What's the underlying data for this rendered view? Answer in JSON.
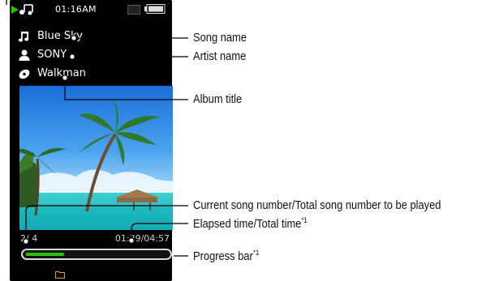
{
  "status_bar": {
    "time": "01:16AM"
  },
  "track": {
    "song": "Blue Sky",
    "artist": "SONY",
    "album": "Walkman"
  },
  "playback": {
    "track_counter": "2/ 4",
    "time_display": "01:29/04:57",
    "progress_fraction": 0.27
  },
  "callouts": {
    "song_name": "Song name",
    "artist_name": "Artist name",
    "album_title": "Album title",
    "song_number": "Current song number/Total song number to be played",
    "elapsed_time": "Elapsed time/Total time",
    "elapsed_time_note": "*1",
    "progress_bar": "Progress bar",
    "progress_bar_note": "*1"
  },
  "colors": {
    "progress_fill": "#27c300",
    "play_indicator": "#27c300",
    "folder_icon": "#e8a000",
    "screen_bg": "#000000"
  },
  "icons": [
    "play-indicator-icon",
    "music-note-icon",
    "person-icon",
    "album-disc-icon",
    "battery-icon",
    "folder-icon"
  ]
}
